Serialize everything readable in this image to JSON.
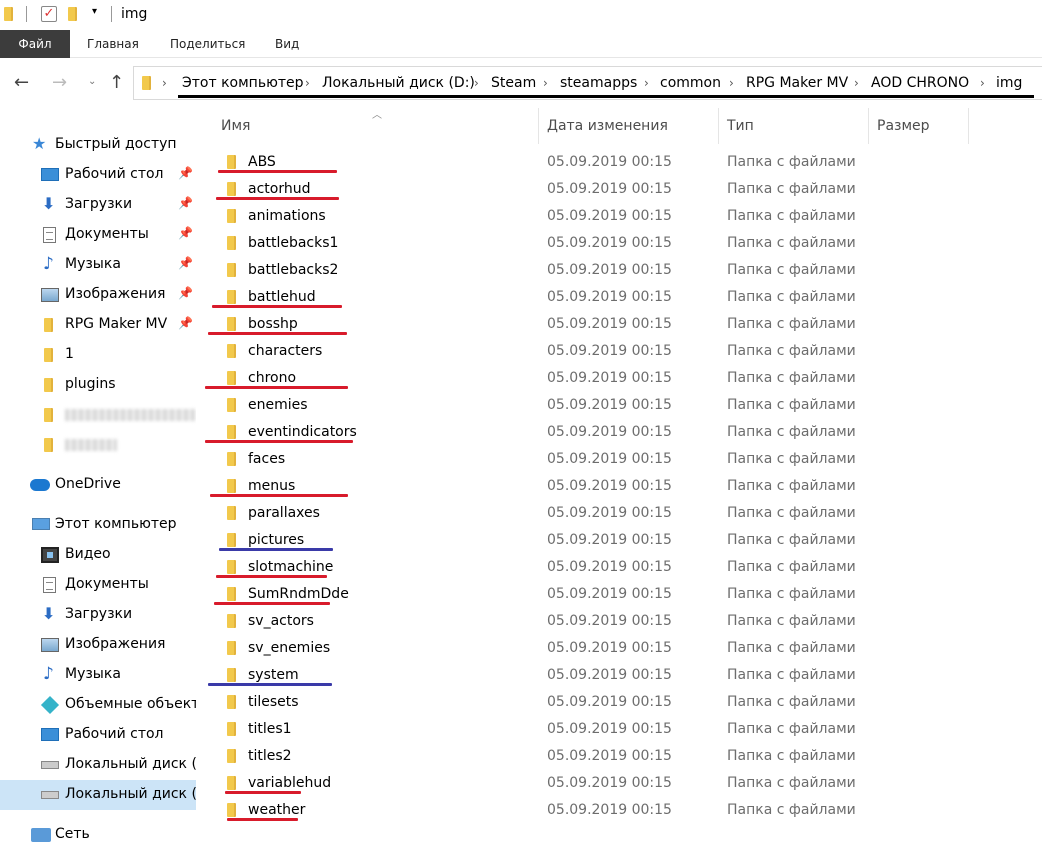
{
  "window": {
    "title": "img"
  },
  "ribbon": {
    "tabs": [
      "Файл",
      "Главная",
      "Поделиться",
      "Вид"
    ]
  },
  "address": {
    "breadcrumbs": [
      "Этот компьютер",
      "Локальный диск (D:)",
      "Steam",
      "steamapps",
      "common",
      "RPG Maker MV",
      "AOD CHRONO",
      "img"
    ]
  },
  "sidebar": {
    "quick_access": "Быстрый доступ",
    "quick_items": [
      {
        "label": "Рабочий стол",
        "icon": "desktop-icon",
        "pinned": true
      },
      {
        "label": "Загрузки",
        "icon": "downloads-icon",
        "pinned": true
      },
      {
        "label": "Документы",
        "icon": "documents-icon",
        "pinned": true
      },
      {
        "label": "Музыка",
        "icon": "music-icon",
        "pinned": true
      },
      {
        "label": "Изображения",
        "icon": "pictures-icon",
        "pinned": true
      },
      {
        "label": "RPG Maker MV",
        "icon": "folder-icon",
        "pinned": true
      },
      {
        "label": "1",
        "icon": "folder-icon",
        "pinned": false
      },
      {
        "label": "plugins",
        "icon": "folder-icon",
        "pinned": false
      }
    ],
    "onedrive": "OneDrive",
    "this_pc": "Этот компьютер",
    "pc_items": [
      {
        "label": "Видео",
        "icon": "video-icon"
      },
      {
        "label": "Документы",
        "icon": "documents-icon"
      },
      {
        "label": "Загрузки",
        "icon": "downloads-icon"
      },
      {
        "label": "Изображения",
        "icon": "pictures-icon"
      },
      {
        "label": "Музыка",
        "icon": "music-icon"
      },
      {
        "label": "Объемные объекты",
        "icon": "3d-objects-icon"
      },
      {
        "label": "Рабочий стол",
        "icon": "desktop-icon"
      },
      {
        "label": "Локальный диск (C:)",
        "icon": "drive-icon"
      },
      {
        "label": "Локальный диск (D:)",
        "icon": "drive-icon",
        "selected": true
      }
    ],
    "network": "Сеть"
  },
  "columns": {
    "name": "Имя",
    "date": "Дата изменения",
    "type": "Тип",
    "size": "Размер"
  },
  "files": [
    {
      "name": "ABS",
      "date": "05.09.2019 00:15",
      "type": "Папка с файлами",
      "mark": "red"
    },
    {
      "name": "actorhud",
      "date": "05.09.2019 00:15",
      "type": "Папка с файлами",
      "mark": "red"
    },
    {
      "name": "animations",
      "date": "05.09.2019 00:15",
      "type": "Папка с файлами",
      "mark": ""
    },
    {
      "name": "battlebacks1",
      "date": "05.09.2019 00:15",
      "type": "Папка с файлами",
      "mark": ""
    },
    {
      "name": "battlebacks2",
      "date": "05.09.2019 00:15",
      "type": "Папка с файлами",
      "mark": ""
    },
    {
      "name": "battlehud",
      "date": "05.09.2019 00:15",
      "type": "Папка с файлами",
      "mark": "red"
    },
    {
      "name": "bosshp",
      "date": "05.09.2019 00:15",
      "type": "Папка с файлами",
      "mark": "red"
    },
    {
      "name": "characters",
      "date": "05.09.2019 00:15",
      "type": "Папка с файлами",
      "mark": ""
    },
    {
      "name": "chrono",
      "date": "05.09.2019 00:15",
      "type": "Папка с файлами",
      "mark": "red"
    },
    {
      "name": "enemies",
      "date": "05.09.2019 00:15",
      "type": "Папка с файлами",
      "mark": ""
    },
    {
      "name": "eventindicators",
      "date": "05.09.2019 00:15",
      "type": "Папка с файлами",
      "mark": "red"
    },
    {
      "name": "faces",
      "date": "05.09.2019 00:15",
      "type": "Папка с файлами",
      "mark": ""
    },
    {
      "name": "menus",
      "date": "05.09.2019 00:15",
      "type": "Папка с файлами",
      "mark": "red"
    },
    {
      "name": "parallaxes",
      "date": "05.09.2019 00:15",
      "type": "Папка с файлами",
      "mark": ""
    },
    {
      "name": "pictures",
      "date": "05.09.2019 00:15",
      "type": "Папка с файлами",
      "mark": "blue"
    },
    {
      "name": "slotmachine",
      "date": "05.09.2019 00:15",
      "type": "Папка с файлами",
      "mark": "red"
    },
    {
      "name": "SumRndmDde",
      "date": "05.09.2019 00:15",
      "type": "Папка с файлами",
      "mark": "red"
    },
    {
      "name": "sv_actors",
      "date": "05.09.2019 00:15",
      "type": "Папка с файлами",
      "mark": ""
    },
    {
      "name": "sv_enemies",
      "date": "05.09.2019 00:15",
      "type": "Папка с файлами",
      "mark": ""
    },
    {
      "name": "system",
      "date": "05.09.2019 00:15",
      "type": "Папка с файлами",
      "mark": "blue"
    },
    {
      "name": "tilesets",
      "date": "05.09.2019 00:15",
      "type": "Папка с файлами",
      "mark": ""
    },
    {
      "name": "titles1",
      "date": "05.09.2019 00:15",
      "type": "Папка с файлами",
      "mark": ""
    },
    {
      "name": "titles2",
      "date": "05.09.2019 00:15",
      "type": "Папка с файлами",
      "mark": ""
    },
    {
      "name": "variablehud",
      "date": "05.09.2019 00:15",
      "type": "Папка с файлами",
      "mark": "red"
    },
    {
      "name": "weather",
      "date": "05.09.2019 00:15",
      "type": "Папка с файлами",
      "mark": "red"
    }
  ],
  "colors": {
    "annotation_red": "#d81b2b",
    "annotation_blue": "#3a3aa8",
    "selected_bg": "#cce4f7",
    "folder": "#f2c94c"
  }
}
